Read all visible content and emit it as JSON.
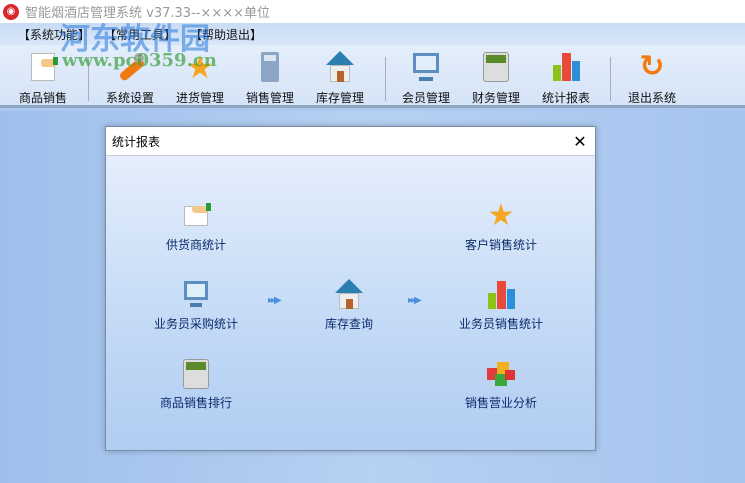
{
  "window": {
    "title": "智能烟酒店管理系统 v37.33--××××单位"
  },
  "watermark": {
    "text": "河东软件园",
    "url": "www.pc0359.cn"
  },
  "menu": [
    "【系统功能】",
    "【常用工具】",
    "【帮助退出】"
  ],
  "toolbar": [
    {
      "label": "商品销售",
      "icon": "sales-paper-icon"
    },
    {
      "label": "系统设置",
      "icon": "wrench-icon"
    },
    {
      "label": "进货管理",
      "icon": "star-icon"
    },
    {
      "label": "销售管理",
      "icon": "calculator-icon"
    },
    {
      "label": "库存管理",
      "icon": "house-icon"
    },
    {
      "label": "会员管理",
      "icon": "monitor-icon"
    },
    {
      "label": "财务管理",
      "icon": "calculator-icon"
    },
    {
      "label": "统计报表",
      "icon": "bar-chart-icon"
    },
    {
      "label": "退出系统",
      "icon": "refresh-exit-icon"
    }
  ],
  "dialog": {
    "title": "统计报表",
    "items": [
      {
        "label": "供货商统计",
        "icon": "handshake-paper-icon"
      },
      {
        "label": "客户销售统计",
        "icon": "star-icon"
      },
      {
        "label": "业务员采购统计",
        "icon": "monitor-icon"
      },
      {
        "label": "库存查询",
        "icon": "house-icon"
      },
      {
        "label": "业务员销售统计",
        "icon": "bar-chart-icon"
      },
      {
        "label": "商品销售排行",
        "icon": "calculator-icon"
      },
      {
        "label": "销售营业分析",
        "icon": "cubes-icon"
      }
    ]
  }
}
